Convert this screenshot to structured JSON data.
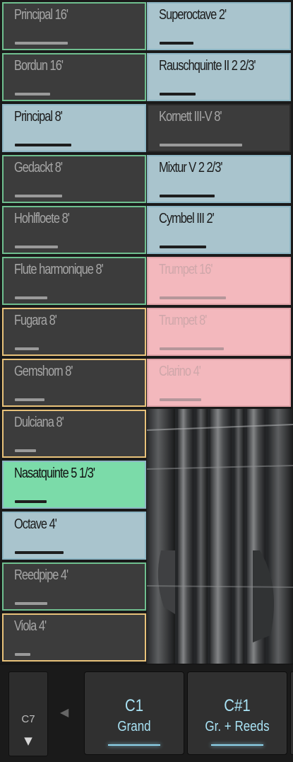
{
  "stops": [
    {
      "label": "Principal 16'",
      "state": "off",
      "level": 0.47
    },
    {
      "label": "Bordun 16'",
      "state": "off",
      "level": 0.31
    },
    {
      "label": "Principal 8'",
      "state": "on",
      "level": 0.5
    },
    {
      "label": "Gedackt 8'",
      "state": "off",
      "level": 0.42
    },
    {
      "label": "Hohlfloete 8'",
      "state": "off",
      "level": 0.38
    },
    {
      "label": "Flute harmonique 8'",
      "state": "off",
      "level": 0.29
    },
    {
      "label": "Fugara 8'",
      "state": "off",
      "level": 0.21
    },
    {
      "label": "Gemshorn 8'",
      "state": "off",
      "level": 0.26
    },
    {
      "label": "Dulciana 8'",
      "state": "off",
      "level": 0.19
    },
    {
      "label": "Nasatquinte 5 1/3'",
      "state": "on",
      "level": 0.28
    },
    {
      "label": "Octave 4'",
      "state": "on",
      "level": 0.43
    },
    {
      "label": "Reedpipe 4'",
      "state": "off",
      "level": 0.29
    },
    {
      "label": "Viola 4'",
      "state": "off",
      "level": 0.14
    },
    {
      "label": "Superoctave 2'",
      "state": "on",
      "level": 0.3
    },
    {
      "label": "Rauschquinte II 2 2/3'",
      "state": "on",
      "level": 0.32
    },
    {
      "label": "Kornett III-V 8'",
      "state": "off",
      "level": 0.73
    },
    {
      "label": "Mixtur V 2 2/3'",
      "state": "on",
      "level": 0.49
    },
    {
      "label": "Cymbel III 2'",
      "state": "on",
      "level": 0.41
    },
    {
      "label": "Trumpet 16'",
      "state": "off",
      "level": 0.59
    },
    {
      "label": "Trumpet 8'",
      "state": "off",
      "level": 0.57
    },
    {
      "label": "Clarino 4'",
      "state": "off",
      "level": 0.37
    }
  ],
  "colors": {
    "principal_on": "#a9c4cd",
    "mutation_on": "#7bdba9",
    "reed_panel": "#f3b8bd",
    "stop_off": "#3c3c3c",
    "border_foundation": "#6fbf8f",
    "border_string": "#e8c27a",
    "border_principal": "#8db6c4",
    "preset_accent": "#a9e3f5"
  },
  "octave": {
    "label": "C7",
    "down_icon": "triangle-down"
  },
  "presets": [
    {
      "key": "C1",
      "name": "Grand"
    },
    {
      "key": "C#1",
      "name": "Gr. + Reeds"
    }
  ]
}
